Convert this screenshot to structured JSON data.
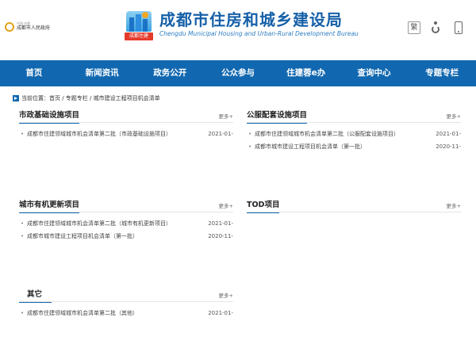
{
  "header": {
    "gov_name": "成都市人民政府",
    "gov_small": "中国·成都",
    "title_cn": "成都市住房和城乡建设局",
    "title_en": "Chengdu Municipal Housing and Urban-Rural Development Bureau",
    "badge_label": "成都住建",
    "traditional_label": "繁"
  },
  "nav": {
    "items": [
      {
        "label": "首页"
      },
      {
        "label": "新闻资讯"
      },
      {
        "label": "政务公开"
      },
      {
        "label": "公众参与"
      },
      {
        "label": "住建蓉e办"
      },
      {
        "label": "查询中心"
      },
      {
        "label": "专题专栏"
      }
    ]
  },
  "breadcrumb": {
    "prefix": "当前位置：",
    "path": "首页 / 专题专栏 / 城市建设工程项目机会清单"
  },
  "sections": {
    "municipal": {
      "title": "市政基础设施项目",
      "more": "更多+",
      "items": [
        {
          "text": "成都市住建领域城市机会清单第二批（市政基础设施项目）",
          "date": "2021-01-"
        }
      ]
    },
    "public": {
      "title": "公服配套设施项目",
      "more": "更多+",
      "items": [
        {
          "text": "成都市住建领域城市机会清单第二批（公服配套设施项目）",
          "date": "2021-01-"
        },
        {
          "text": "成都市城市建设工程项目机会清单（第一批）",
          "date": "2020-11-"
        }
      ]
    },
    "renewal": {
      "title": "城市有机更新项目",
      "more": "更多+",
      "items": [
        {
          "text": "成都市住建领域城市机会清单第二批（城市有机更新项目）",
          "date": "2021-01-"
        },
        {
          "text": "成都市城市建设工程项目机会清单（第一批）",
          "date": "2020-11-"
        }
      ]
    },
    "tod": {
      "title": "TOD项目",
      "more": "更多+",
      "items": []
    },
    "other": {
      "title": "其它",
      "more": "更多+",
      "items": [
        {
          "text": "成都市住建领域城市机会清单第二批（其他）",
          "date": "2021-01-"
        }
      ]
    }
  },
  "colors": {
    "nav_bg": "#1268b0",
    "brand": "#1660a8"
  }
}
